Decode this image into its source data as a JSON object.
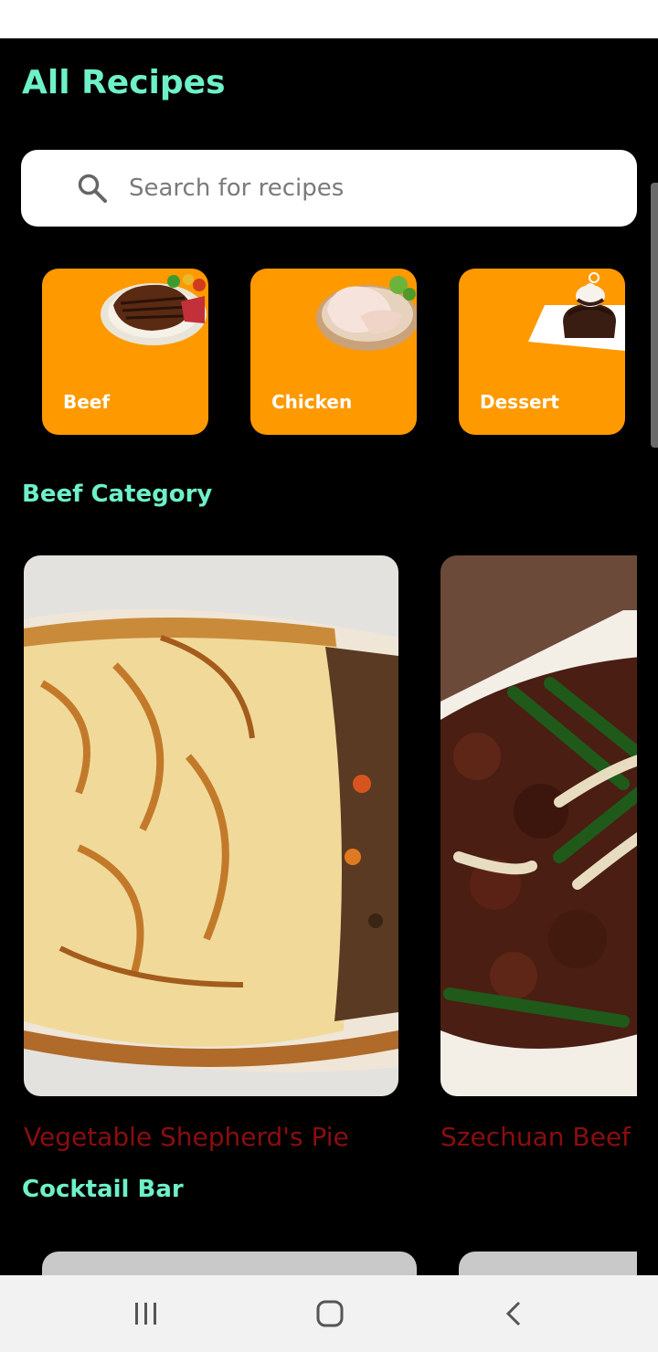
{
  "header": {
    "title": "All Recipes"
  },
  "search": {
    "placeholder": "Search for recipes",
    "icon": "search-icon"
  },
  "categories": [
    {
      "label": "Beef",
      "image": "steak-plate"
    },
    {
      "label": "Chicken",
      "image": "raw-chicken-plate"
    },
    {
      "label": "Dessert",
      "image": "chocolate-cake-plate"
    }
  ],
  "sections": {
    "beef": {
      "title": "Beef Category",
      "recipes": [
        {
          "name": "Vegetable Shepherd's Pie",
          "image": "shepherds-pie-photo"
        },
        {
          "name": "Szechuan Beef",
          "image": "szechuan-beef-photo"
        }
      ]
    },
    "cocktail": {
      "title": "Cocktail Bar"
    }
  },
  "nav": {
    "recents": "recents-icon",
    "home": "home-icon",
    "back": "back-icon"
  },
  "colors": {
    "accent": "#6ef0c8",
    "category_bg": "#ff9900",
    "recipe_name": "#8a0e0e",
    "background": "#000000"
  }
}
